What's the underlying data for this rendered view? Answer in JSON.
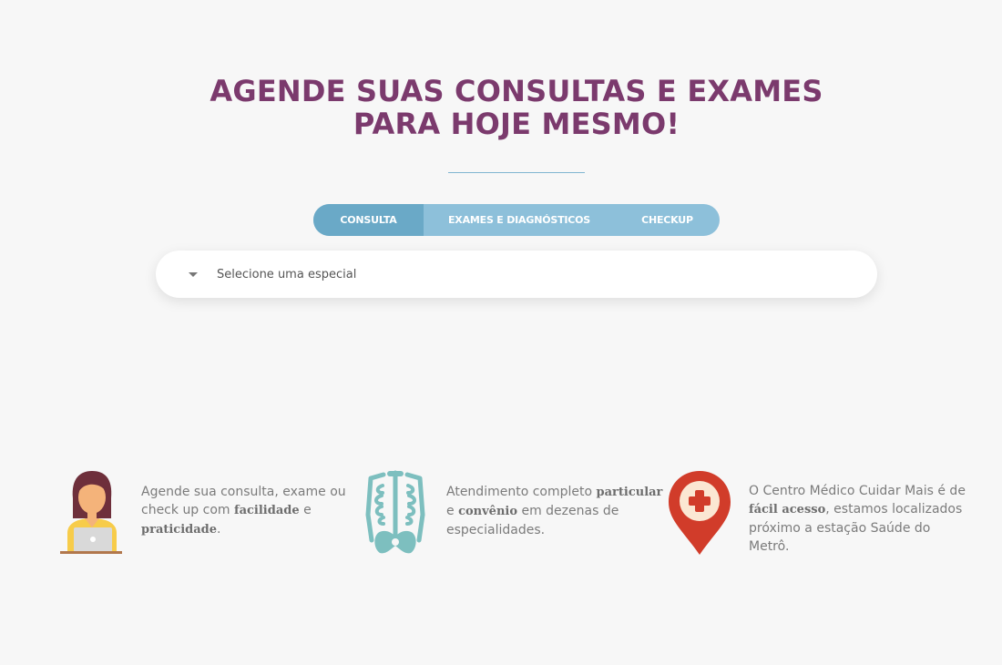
{
  "hero": {
    "title_line1": "AGENDE SUAS CONSULTAS E EXAMES",
    "title_line2": "PARA HOJE MESMO!"
  },
  "tabs": [
    {
      "label": "CONSULTA",
      "active": true
    },
    {
      "label": "EXAMES E DIAGNÓSTICOS",
      "active": false
    },
    {
      "label": "CHECKUP",
      "active": false
    }
  ],
  "search": {
    "placeholder": "Selecione uma especialidade"
  },
  "features": [
    {
      "icon": "woman-laptop-icon",
      "parts": [
        "Agende sua consulta, exame ou check up com ",
        "facilidade",
        " e ",
        "praticidade",
        "."
      ]
    },
    {
      "icon": "skeleton-xray-icon",
      "parts": [
        "Atendimento completo ",
        "particular",
        " e ",
        "convênio",
        " em dezenas de especialidades."
      ]
    },
    {
      "icon": "location-pin-cross-icon",
      "parts": [
        "O Centro Médico Cuidar Mais é de ",
        "fácil acesso",
        ", estamos localizados próximo a estação Saúde do Metrô."
      ]
    }
  ],
  "colors": {
    "title": "#7b3a6d",
    "tab_active": "#6aa9c7",
    "tab_bg": "#8dc0da",
    "divider": "#7fb5d0",
    "pin": "#d13c2a",
    "skeleton": "#7dbfbf"
  }
}
